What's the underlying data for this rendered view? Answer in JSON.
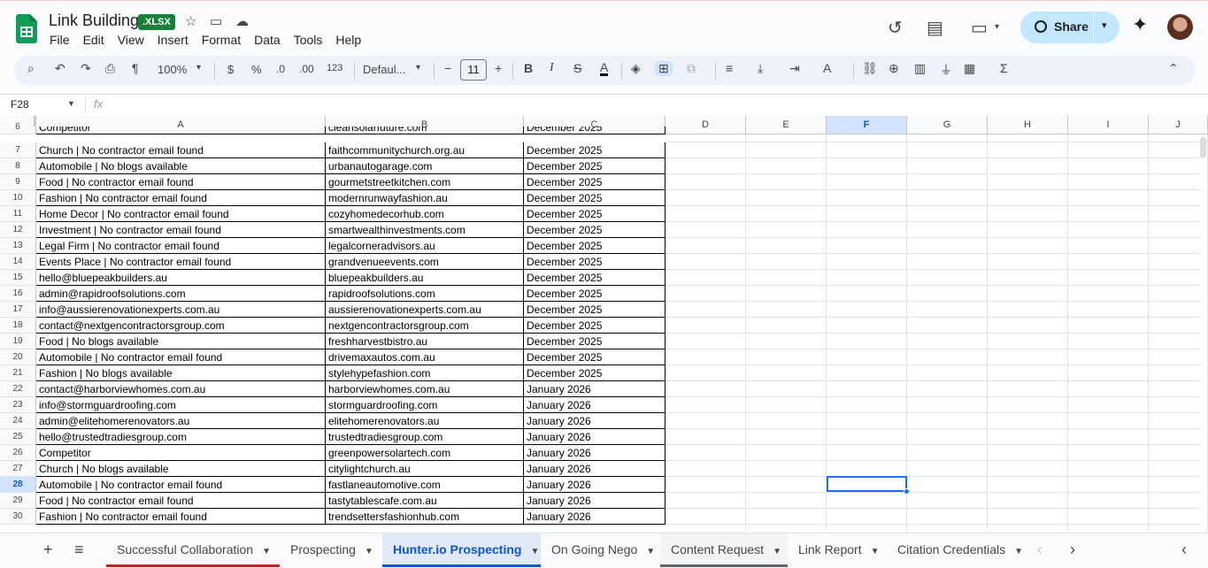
{
  "app": {
    "title": "Link Building",
    "badge": ".XLSX",
    "menu": [
      "File",
      "Edit",
      "View",
      "Insert",
      "Format",
      "Data",
      "Tools",
      "Help"
    ],
    "share_label": "Share"
  },
  "toolbar": {
    "zoom": "100%",
    "currency": "$",
    "percent": "%",
    "dec_decrease": ".0",
    "dec_increase": ".00",
    "num_format": "123",
    "font": "Defaul...",
    "font_size": "11"
  },
  "formula_bar": {
    "name_box": "F28",
    "fx": "fx",
    "content": ""
  },
  "columns": [
    "A",
    "B",
    "C",
    "D",
    "E",
    "F",
    "G",
    "H",
    "I",
    "J"
  ],
  "selected_column": "F",
  "selected_row": "28",
  "partial_row": {
    "num": "6",
    "a": "Competitor",
    "b": "cleansolarfuture.com",
    "c": "December 2025"
  },
  "rows": [
    {
      "num": "7",
      "a": "Church | No contractor email found",
      "b": "faithcommunitychurch.org.au",
      "c": "December 2025"
    },
    {
      "num": "8",
      "a": "Automobile | No blogs available",
      "b": "urbanautogarage.com",
      "c": "December 2025"
    },
    {
      "num": "9",
      "a": "Food | No contractor email found",
      "b": "gourmetstreetkitchen.com",
      "c": "December 2025"
    },
    {
      "num": "10",
      "a": "Fashion | No contractor email found",
      "b": "modernrunwayfashion.au",
      "c": "December 2025"
    },
    {
      "num": "11",
      "a": "Home Decor | No contractor email found",
      "b": "cozyhomedecorhub.com",
      "c": "December 2025"
    },
    {
      "num": "12",
      "a": "Investment | No contractor email found",
      "b": "smartwealthinvestments.com",
      "c": "December 2025"
    },
    {
      "num": "13",
      "a": "Legal Firm | No contractor email found",
      "b": "legalcorneradvisors.au",
      "c": "December 2025"
    },
    {
      "num": "14",
      "a": "Events Place | No contractor email found",
      "b": "grandvenueevents.com",
      "c": "December 2025"
    },
    {
      "num": "15",
      "a": "hello@bluepeakbuilders.au",
      "b": "bluepeakbuilders.au",
      "c": "December 2025"
    },
    {
      "num": "16",
      "a": "admin@rapidroofsolutions.com",
      "b": "rapidroofsolutions.com",
      "c": "December 2025"
    },
    {
      "num": "17",
      "a": "info@aussierenovationexperts.com.au",
      "b": "aussierenovationexperts.com.au",
      "c": "December 2025"
    },
    {
      "num": "18",
      "a": "contact@nextgencontractorsgroup.com",
      "b": "nextgencontractorsgroup.com",
      "c": "December 2025"
    },
    {
      "num": "19",
      "a": "Food | No blogs available",
      "b": "freshharvestbistro.au",
      "c": "December 2025"
    },
    {
      "num": "20",
      "a": "Automobile | No contractor email found",
      "b": "drivemaxautos.com.au",
      "c": "December 2025"
    },
    {
      "num": "21",
      "a": "Fashion | No blogs available",
      "b": "stylehypefashion.com",
      "c": "December 2025"
    },
    {
      "num": "22",
      "a": "contact@harborviewhomes.com.au",
      "b": "harborviewhomes.com.au",
      "c": "January 2026"
    },
    {
      "num": "23",
      "a": "info@stormguardroofing.com",
      "b": "stormguardroofing.com",
      "c": "January 2026"
    },
    {
      "num": "24",
      "a": "admin@elitehomerenovators.au",
      "b": "elitehomerenovators.au",
      "c": "January 2026"
    },
    {
      "num": "25",
      "a": "hello@trustedtradiesgroup.com",
      "b": "trustedtradiesgroup.com",
      "c": "January 2026"
    },
    {
      "num": "26",
      "a": "Competitor",
      "b": "greenpowersolartech.com",
      "c": "January 2026"
    },
    {
      "num": "27",
      "a": "Church | No blogs available",
      "b": "citylightchurch.au",
      "c": "January 2026"
    },
    {
      "num": "28",
      "a": "Automobile | No contractor email found",
      "b": "fastlaneautomotive.com",
      "c": "January 2026"
    },
    {
      "num": "29",
      "a": "Food | No contractor email found",
      "b": "tastytablescafe.com.au",
      "c": "January 2026"
    },
    {
      "num": "30",
      "a": "Fashion | No contractor email found",
      "b": "trendsettersfashionhub.com",
      "c": "January 2026"
    }
  ],
  "sheets": [
    {
      "name": "Successful Collaboration",
      "underline": "#c5221f"
    },
    {
      "name": "Prospecting",
      "underline": ""
    },
    {
      "name": "Hunter.io Prospecting",
      "underline": "#0b57d0"
    },
    {
      "name": "On Going Nego",
      "underline": ""
    },
    {
      "name": "Content Request",
      "underline": "#5f6368"
    },
    {
      "name": "Link Report",
      "underline": ""
    },
    {
      "name": "Citation Credentials",
      "underline": ""
    }
  ],
  "active_sheet": "Hunter.io Prospecting",
  "colors": {
    "accent": "#0b57d0",
    "share_bg": "#c2e7ff",
    "sheets_green": "#0f9d58",
    "xlsx_badge": "#188038"
  }
}
